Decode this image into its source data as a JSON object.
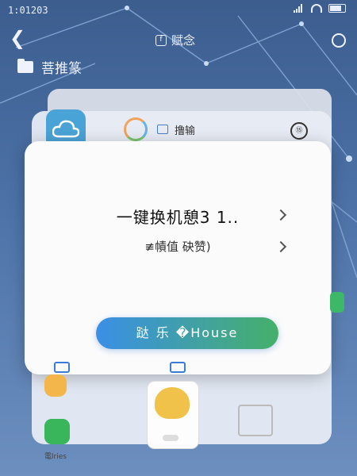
{
  "status_bar": {
    "time": "1:01203"
  },
  "header": {
    "title": "赋念",
    "title_icon_glyph": "f"
  },
  "folder": {
    "label": "菩推篆"
  },
  "card": {
    "app_label": "撸输",
    "timer_glyph": "⑮"
  },
  "dialog": {
    "option1": "一键换机憩3  1..",
    "option2": "≢幘值 砄赞)",
    "button": "跶 乐 �House"
  },
  "dock": {
    "phone_label": "電lries"
  },
  "colors": {
    "accent_blue": "#3b8fe6",
    "accent_green": "#45b06a"
  }
}
